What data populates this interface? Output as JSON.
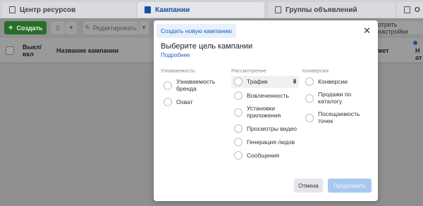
{
  "tabs": [
    {
      "label": "Центр ресурсов",
      "icon": "clipboard-icon"
    },
    {
      "label": "Кампании",
      "icon": "folder-icon"
    },
    {
      "label": "Группы объявлений",
      "icon": "grid-icon"
    },
    {
      "label": "О",
      "icon": "document-icon"
    }
  ],
  "toolbar": {
    "create_label": "Создать",
    "edit_label": "Редактировать",
    "settings_label": "отреть настройки"
  },
  "table": {
    "columns": [
      "Выкл/ вкл",
      "Название кампании",
      "жет",
      "Н ат"
    ]
  },
  "modal": {
    "tab_label": "Создать новую кампанию",
    "title": "Выберите цель кампании",
    "more_link": "Подробнее",
    "categories": [
      {
        "title": "Узнаваемость",
        "options": [
          "Узнаваемость бренда",
          "Охват"
        ]
      },
      {
        "title": "Рассмотрение",
        "options": [
          "Трафик",
          "Вовлеченность",
          "Установки приложения",
          "Просмотры видео",
          "Генерация лидов",
          "Сообщения"
        ]
      },
      {
        "title": "Конверсия",
        "options": [
          "Конверсии",
          "Продажи по каталогу",
          "Посещаемость точек"
        ]
      }
    ],
    "cancel_label": "Отмена",
    "continue_label": "Продолжить"
  },
  "colors": {
    "accent": "#1a5bc4",
    "create_button": "#286e2a",
    "continue_button_disabled": "#a9c8ef"
  }
}
